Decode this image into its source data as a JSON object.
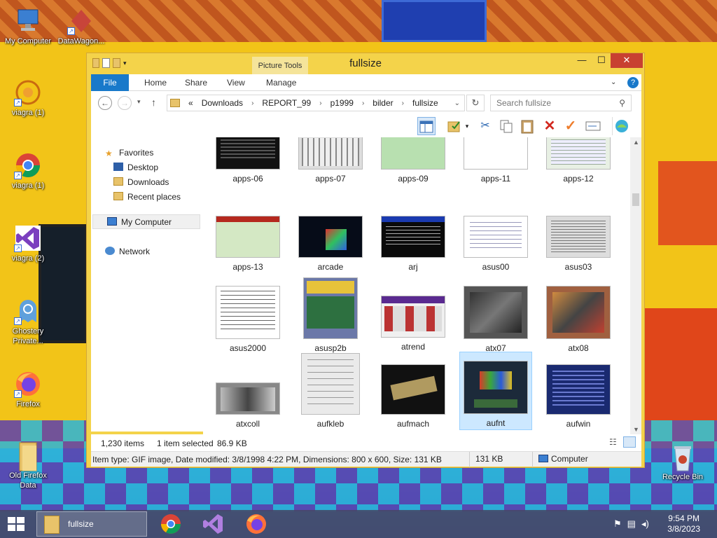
{
  "desktop": {
    "icons": [
      {
        "label": "My Computer",
        "icon": "computer-icon"
      },
      {
        "label": "DataWagon...",
        "icon": "datawagon-icon"
      },
      {
        "label": "viagra (1)",
        "icon": "viagra-icon"
      },
      {
        "label": "viagra (1)",
        "icon": "chrome-icon"
      },
      {
        "label": "viagra (2)",
        "icon": "visual-studio-icon"
      },
      {
        "label": "Ghostery Private...",
        "icon": "ghostery-icon"
      },
      {
        "label": "Firefox",
        "icon": "firefox-icon"
      },
      {
        "label": "Old Firefox Data",
        "icon": "folder-icon"
      },
      {
        "label": "Recycle Bin",
        "icon": "recycle-bin-icon"
      }
    ]
  },
  "window": {
    "title": "fullsize",
    "picture_tools": "Picture Tools",
    "tabs": [
      "File",
      "Home",
      "Share",
      "View",
      "Manage"
    ],
    "address": {
      "prefix": "«",
      "crumbs": [
        "Downloads",
        "REPORT_99",
        "p1999",
        "bilder",
        "fullsize"
      ]
    },
    "search_placeholder": "Search fullsize",
    "nav": {
      "favorites": "Favorites",
      "desktop": "Desktop",
      "downloads": "Downloads",
      "recent": "Recent places",
      "my_computer": "My Computer",
      "network": "Network"
    },
    "files": [
      "apps-06",
      "apps-07",
      "apps-09",
      "apps-11",
      "apps-12",
      "apps-13",
      "arcade",
      "arj",
      "asus00",
      "asus03",
      "asus2000",
      "asusp2b",
      "atrend",
      "atx07",
      "atx08",
      "atxcoll",
      "aufkleb",
      "aufmach",
      "aufnt",
      "aufwin"
    ],
    "selected_file": "aufnt",
    "status": {
      "item_count": "1,230 items",
      "selection": "1 item selected",
      "selection_size": "86.9 KB",
      "details": "Item type: GIF image, Date modified: 3/8/1998 4:22 PM, Dimensions: 800 x 600, Size: 131 KB",
      "size": "131 KB",
      "location": "Computer"
    }
  },
  "taskbar": {
    "active_label": "fullsize",
    "time": "9:54 PM",
    "date": "3/8/2023"
  },
  "colors": {
    "window_frame": "#f4d34a",
    "file_tab": "#1979ca",
    "close_button": "#c84031",
    "selection": "#cce8ff"
  }
}
